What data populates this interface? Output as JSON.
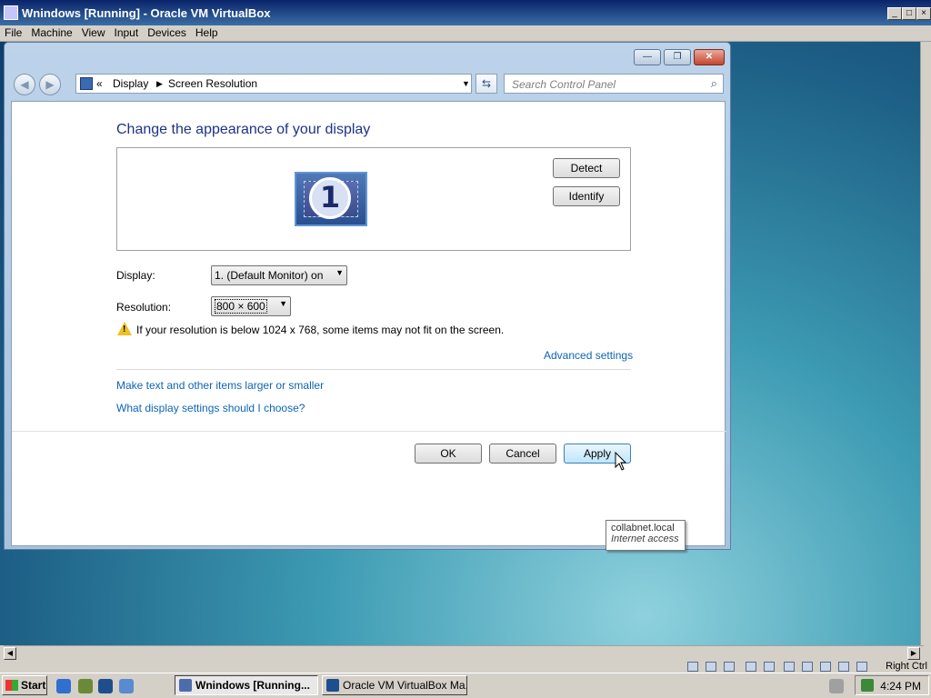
{
  "host": {
    "title": "Wnindows  [Running] - Oracle VM VirtualBox",
    "menu": [
      "File",
      "Machine",
      "View",
      "Input",
      "Devices",
      "Help"
    ],
    "status_right": "Right Ctrl"
  },
  "dialog": {
    "breadcrumb_root": "Display",
    "breadcrumb_current": "Screen Resolution",
    "search_placeholder": "Search Control Panel",
    "heading": "Change the appearance of your display",
    "monitor_number": "1",
    "detect_label": "Detect",
    "identify_label": "Identify",
    "display_label": "Display:",
    "display_value": "1. (Default Monitor) on",
    "resolution_label": "Resolution:",
    "resolution_value": "800 × 600",
    "warning_text": "If your resolution is below 1024 x 768, some items may not fit on the screen.",
    "advanced_link": "Advanced settings",
    "link_text_size": "Make text and other items larger or smaller",
    "link_what_settings": "What display settings should I choose?",
    "ok_label": "OK",
    "cancel_label": "Cancel",
    "apply_label": "Apply"
  },
  "tooltip": {
    "line1": "collabnet.local",
    "line2": "Internet access"
  },
  "taskbar": {
    "start_label": "Start",
    "task1": "Wnindows  [Running...",
    "task2": "Oracle VM VirtualBox Ma...",
    "clock": "4:24 PM"
  },
  "colors": {
    "link": "#0e64b6",
    "heading": "#1e3287",
    "host_title": "#0a246a"
  }
}
